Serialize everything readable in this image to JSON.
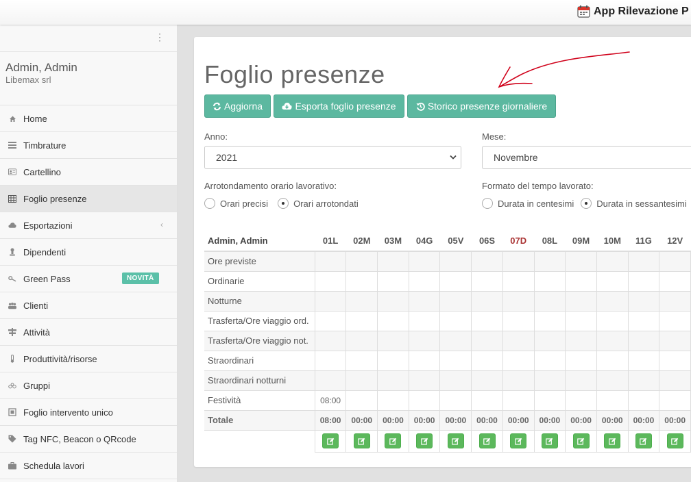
{
  "app": {
    "title": "App Rilevazione P"
  },
  "sidebar": {
    "user_name": "Admin, Admin",
    "company": "Libemax srl",
    "items": [
      {
        "label": "Home",
        "icon": "home-icon"
      },
      {
        "label": "Timbrature",
        "icon": "list-icon"
      },
      {
        "label": "Cartellino",
        "icon": "id-card-icon"
      },
      {
        "label": "Foglio presenze",
        "icon": "table-icon",
        "active": true
      },
      {
        "label": "Esportazioni",
        "icon": "cloud-icon"
      },
      {
        "label": "Dipendenti",
        "icon": "user-icon"
      },
      {
        "label": "Green Pass",
        "icon": "key-icon",
        "badge": "NOVITÀ"
      },
      {
        "label": "Clienti",
        "icon": "users-icon"
      },
      {
        "label": "Attività",
        "icon": "signpost-icon"
      },
      {
        "label": "Produttività/risorse",
        "icon": "thermometer-icon"
      },
      {
        "label": "Gruppi",
        "icon": "group-icon"
      },
      {
        "label": "Foglio intervento unico",
        "icon": "crop-icon"
      },
      {
        "label": "Tag NFC, Beacon o QRcode",
        "icon": "tag-icon"
      },
      {
        "label": "Schedula lavori",
        "icon": "briefcase-icon"
      }
    ]
  },
  "main": {
    "title": "Foglio presenze",
    "buttons": {
      "refresh": "Aggiorna",
      "export": "Esporta foglio presenze",
      "history": "Storico presenze giornaliere"
    },
    "year_label": "Anno:",
    "year_value": "2021",
    "month_label": "Mese:",
    "month_value": "Novembre",
    "rounding_label": "Arrotondamento orario lavorativo:",
    "rounding_options": [
      "Orari precisi",
      "Orari arrotondati"
    ],
    "rounding_selected": 1,
    "format_label": "Formato del tempo lavorato:",
    "format_options": [
      "Durata in centesimi",
      "Durata in sessantesimi"
    ],
    "format_selected": 1
  },
  "table": {
    "header": "Admin, Admin",
    "days": [
      "01L",
      "02M",
      "03M",
      "04G",
      "05V",
      "06S",
      "07D",
      "08L",
      "09M",
      "10M",
      "11G",
      "12V"
    ],
    "sunday_index": 6,
    "rows": [
      {
        "label": "Ore previste",
        "values": [
          "",
          "",
          "",
          "",
          "",
          "",
          "",
          "",
          "",
          "",
          "",
          ""
        ]
      },
      {
        "label": "Ordinarie",
        "values": [
          "",
          "",
          "",
          "",
          "",
          "",
          "",
          "",
          "",
          "",
          "",
          ""
        ]
      },
      {
        "label": "Notturne",
        "values": [
          "",
          "",
          "",
          "",
          "",
          "",
          "",
          "",
          "",
          "",
          "",
          ""
        ]
      },
      {
        "label": "Trasferta/Ore viaggio ord.",
        "values": [
          "",
          "",
          "",
          "",
          "",
          "",
          "",
          "",
          "",
          "",
          "",
          ""
        ]
      },
      {
        "label": "Trasferta/Ore viaggio not.",
        "values": [
          "",
          "",
          "",
          "",
          "",
          "",
          "",
          "",
          "",
          "",
          "",
          ""
        ]
      },
      {
        "label": "Straordinari",
        "values": [
          "",
          "",
          "",
          "",
          "",
          "",
          "",
          "",
          "",
          "",
          "",
          ""
        ]
      },
      {
        "label": "Straordinari notturni",
        "values": [
          "",
          "",
          "",
          "",
          "",
          "",
          "",
          "",
          "",
          "",
          "",
          ""
        ]
      },
      {
        "label": "Festività",
        "values": [
          "08:00",
          "",
          "",
          "",
          "",
          "",
          "",
          "",
          "",
          "",
          "",
          ""
        ]
      }
    ],
    "total": {
      "label": "Totale",
      "values": [
        "08:00",
        "00:00",
        "00:00",
        "00:00",
        "00:00",
        "00:00",
        "00:00",
        "00:00",
        "00:00",
        "00:00",
        "00:00",
        "00:00"
      ]
    }
  },
  "colors": {
    "accent": "#5cb8a0",
    "edit": "#5cb85c",
    "badge": "#5bc0a8",
    "annotation": "#d0021b"
  }
}
